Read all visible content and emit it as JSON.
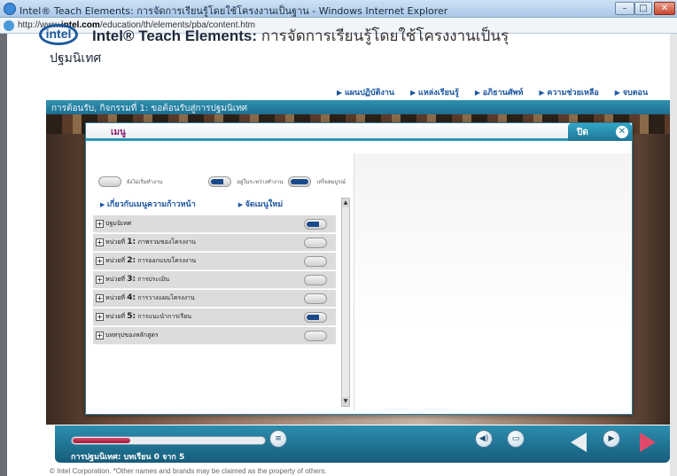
{
  "window": {
    "title": "Intel® Teach Elements: การจัดการเรียนรู้โดยใช้โครงงานเป็นฐาน - Windows Internet Explorer",
    "url_prefix": "http://www.",
    "url_domain": "intel.com",
    "url_path": "/education/th/elements/pba/content.htm"
  },
  "header": {
    "logo": "intel",
    "title_bold": "Intel® Teach Elements:",
    "title_rest": " การจัดการเรียนรู้โดยใช้โครงงานเป็นรุ",
    "section": "ปฐมนิเทศ",
    "nav": [
      "แผนปฏิบัติงาน",
      "แหล่งเรียนรู้",
      "อภิธานศัพท์",
      "ความช่วยเหลือ",
      "จบตอน"
    ],
    "breadcrumb": "การต้อนรับ, กิจกรรมที่ 1: ขอต้อนรับสู่การปฐมนิเทศ"
  },
  "dialog": {
    "menu_label": "เมนู",
    "close_label": "ปิด",
    "legend": [
      "ยังไม่เริ่มทำงาน",
      "อยู่ในระหว่างทำงาน",
      "เสร็จสมบูรณ์"
    ],
    "links": [
      "เกี่ยวกับเมนูความก้าวหน้า",
      "จัดเมนูใหม่"
    ],
    "items": [
      {
        "prefix": "ปฐมนิเทศ",
        "num": "",
        "label": "",
        "status": "half"
      },
      {
        "prefix": "หน่วยที่ ",
        "num": "1:",
        "label": " ภาพรวมของโครงงาน",
        "status": "none"
      },
      {
        "prefix": "หน่วยที่ ",
        "num": "2:",
        "label": " การออกแบบโครงงาน",
        "status": "none"
      },
      {
        "prefix": "หน่วยที่ ",
        "num": "3:",
        "label": " การประเมิน",
        "status": "none"
      },
      {
        "prefix": "หน่วยที่ ",
        "num": "4:",
        "label": " การวางแผนโครงงาน",
        "status": "none"
      },
      {
        "prefix": "หน่วยที่ ",
        "num": "5:",
        "label": " การแนะนำการเรียน",
        "status": "half"
      },
      {
        "prefix": "บทสรุปของหลักสูตร",
        "num": "",
        "label": "",
        "status": "none"
      }
    ]
  },
  "player": {
    "progress": 0.3,
    "label": "การปฐมนิเทศ: บทเรียน 0 จาก 5"
  },
  "footer": "© Intel Corporation. *Other names and brands may be claimed as the property of others."
}
